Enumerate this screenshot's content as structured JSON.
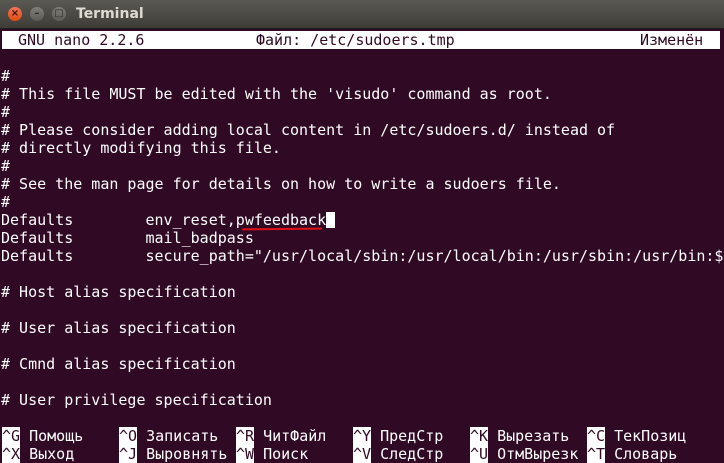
{
  "window": {
    "title": "Terminal",
    "buttons": {
      "close": "×",
      "minimize": "–",
      "maximize": "□"
    }
  },
  "nano": {
    "version": "GNU nano 2.2.6",
    "file_label": "Файл: /etc/sudoers.tmp",
    "status": "Изменён"
  },
  "lines": [
    "#",
    "# This file MUST be edited with the 'visudo' command as root.",
    "#",
    "# Please consider adding local content in /etc/sudoers.d/ instead of",
    "# directly modifying this file.",
    "#",
    "# See the man page for details on how to write a sudoers file.",
    "#",
    "Defaults        env_reset,pwfeedback",
    "Defaults        mail_badpass",
    "Defaults        secure_path=\"/usr/local/sbin:/usr/local/bin:/usr/sbin:/usr/bin:$",
    "",
    "# Host alias specification",
    "",
    "# User alias specification",
    "",
    "# Cmnd alias specification",
    "",
    "# User privilege specification"
  ],
  "shortcuts": [
    {
      "key": "^G",
      "label": "Помощь"
    },
    {
      "key": "^O",
      "label": "Записать"
    },
    {
      "key": "^R",
      "label": "ЧитФайл"
    },
    {
      "key": "^Y",
      "label": "ПредСтр"
    },
    {
      "key": "^K",
      "label": "Вырезать"
    },
    {
      "key": "^C",
      "label": "ТекПозиц"
    },
    {
      "key": "^X",
      "label": "Выход"
    },
    {
      "key": "^J",
      "label": "Выровнять"
    },
    {
      "key": "^W",
      "label": "Поиск"
    },
    {
      "key": "^V",
      "label": "СледСтр"
    },
    {
      "key": "^U",
      "label": "ОтмВырезк"
    },
    {
      "key": "^T",
      "label": "Словарь"
    }
  ],
  "colors": {
    "background": "#300a24",
    "text": "#ffffff",
    "highlight": "#e0101a"
  }
}
